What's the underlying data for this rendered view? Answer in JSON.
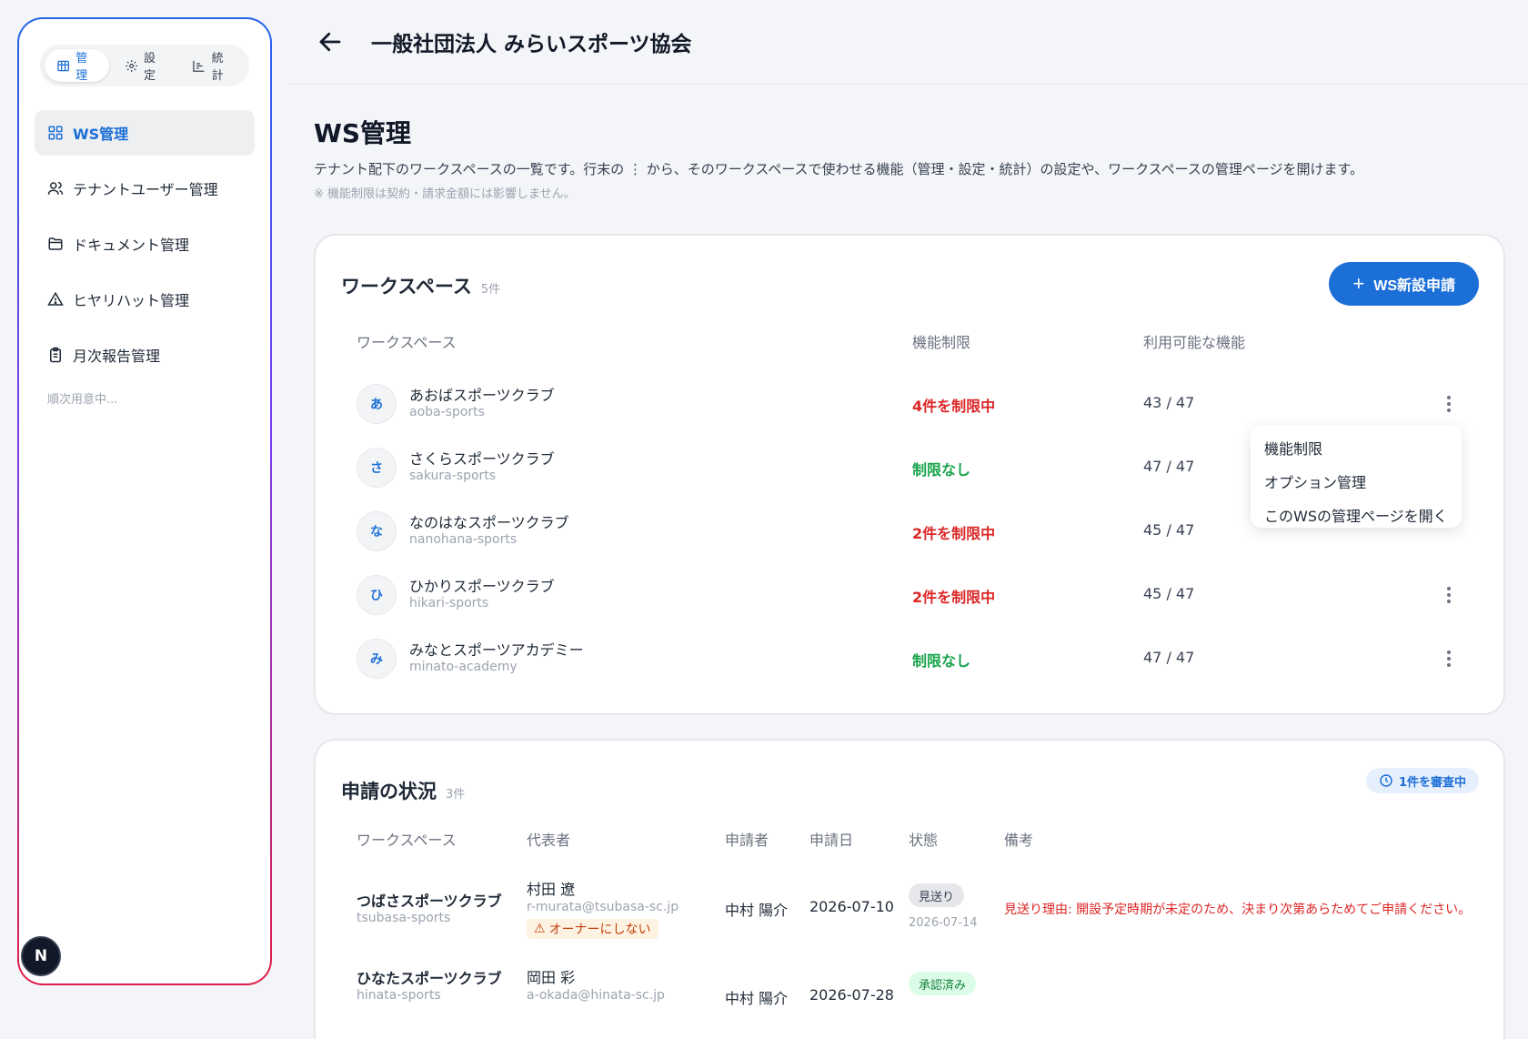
{
  "sidebar": {
    "segments": [
      {
        "label": "管理",
        "active": true
      },
      {
        "label": "設定",
        "active": false
      },
      {
        "label": "統計",
        "active": false
      }
    ],
    "nav": [
      {
        "label": "WS管理",
        "icon": "grid-icon",
        "active": true
      },
      {
        "label": "テナントユーザー管理",
        "icon": "users-icon",
        "active": false
      },
      {
        "label": "ドキュメント管理",
        "icon": "folder-icon",
        "active": false
      },
      {
        "label": "ヒヤリハット管理",
        "icon": "warning-icon",
        "active": false
      },
      {
        "label": "月次報告管理",
        "icon": "clipboard-icon",
        "active": false
      }
    ],
    "note": "順次用意中...",
    "badge": "N"
  },
  "header": {
    "title": "一般社団法人 みらいスポーツ協会"
  },
  "page": {
    "title": "WS管理",
    "description": "テナント配下のワークスペースの一覧です。行末の ⋮ から、そのワークスペースで使わせる機能（管理・設定・統計）の設定や、ワークスペースの管理ページを開けます。",
    "note": "※ 機能制限は契約・請求金額には影響しません。"
  },
  "workspaces": {
    "title": "ワークスペース",
    "count": "5件",
    "new_button": "WS新設申請",
    "columns": {
      "workspace": "ワークスペース",
      "restriction": "機能制限",
      "available": "利用可能な機能"
    },
    "rows": [
      {
        "initial": "あ",
        "name": "あおばスポーツクラブ",
        "slug": "aoba-sports",
        "restriction": "4件を制限中",
        "restricted": true,
        "available": "43 / 47"
      },
      {
        "initial": "さ",
        "name": "さくらスポーツクラブ",
        "slug": "sakura-sports",
        "restriction": "制限なし",
        "restricted": false,
        "available": "47 / 47"
      },
      {
        "initial": "な",
        "name": "なのはなスポーツクラブ",
        "slug": "nanohana-sports",
        "restriction": "2件を制限中",
        "restricted": true,
        "available": "45 / 47"
      },
      {
        "initial": "ひ",
        "name": "ひかりスポーツクラブ",
        "slug": "hikari-sports",
        "restriction": "2件を制限中",
        "restricted": true,
        "available": "45 / 47"
      },
      {
        "initial": "み",
        "name": "みなとスポーツアカデミー",
        "slug": "minato-academy",
        "restriction": "制限なし",
        "restricted": false,
        "available": "47 / 47"
      }
    ],
    "menu": [
      "機能制限",
      "オプション管理",
      "このWSの管理ページを開く"
    ]
  },
  "applications": {
    "title": "申請の状況",
    "count": "3件",
    "review_badge": "1件を審査中",
    "columns": {
      "workspace": "ワークスペース",
      "representative": "代表者",
      "applicant": "申請者",
      "date": "申請日",
      "status": "状態",
      "remarks": "備考"
    },
    "rows": [
      {
        "ws_name": "つばさスポーツクラブ",
        "ws_slug": "tsubasa-sports",
        "rep_name": "村田 遼",
        "rep_email": "r-murata@tsubasa-sc.jp",
        "rep_warning": "オーナーにしない",
        "applicant": "中村 陽介",
        "date": "2026-07-10",
        "status": "見送り",
        "status_date": "2026-07-14",
        "remark": "見送り理由: 開設予定時期が未定のため、決まり次第あらためてご申請ください。"
      },
      {
        "ws_name": "ひなたスポーツクラブ",
        "ws_slug": "hinata-sports",
        "rep_name": "岡田 彩",
        "rep_email": "a-okada@hinata-sc.jp",
        "applicant": "中村 陽介",
        "date": "2026-07-28",
        "status": "承認済み"
      }
    ]
  },
  "colors": {
    "accent": "#1d6fd8",
    "danger": "#dc2626",
    "success": "#16a34a"
  }
}
